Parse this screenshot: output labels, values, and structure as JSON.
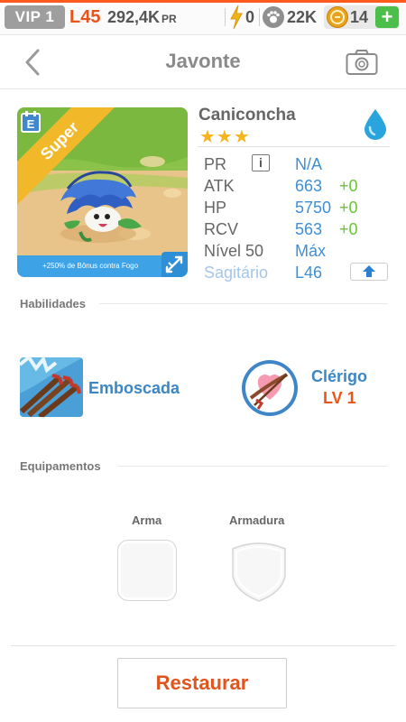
{
  "status_bar": {
    "vip": "VIP 1",
    "level": "L45",
    "pr_value": "292,4K",
    "pr_unit": "PR",
    "energy": "0",
    "paw_count": "22K",
    "coins": "14",
    "add_label": "+"
  },
  "nav": {
    "title": "Javonte"
  },
  "card": {
    "rarity": "Super",
    "bonus_text": "+250% de Bônus contra Fogo",
    "type_letter": "E"
  },
  "monster": {
    "name": "Caniconcha",
    "stars": "★★★",
    "element_icon": "water-drop-icon",
    "stats": [
      {
        "label": "PR",
        "value": "N/A",
        "bonus": ""
      },
      {
        "label": "ATK",
        "value": "663",
        "bonus": "+0"
      },
      {
        "label": "HP",
        "value": "5750",
        "bonus": "+0"
      },
      {
        "label": "RCV",
        "value": "563",
        "bonus": "+0"
      },
      {
        "label": "Nível 50",
        "value": "Máx",
        "bonus": ""
      },
      {
        "label": "Sagitário",
        "value": "L46",
        "bonus": ""
      }
    ],
    "info_icon_label": "i"
  },
  "abilities": {
    "title": "Habilidades",
    "skill1": {
      "name": "Emboscada",
      "icon": "arrows-icon"
    },
    "skill2": {
      "name": "Clérigo",
      "level": "LV 1",
      "icon": "heart-bow-icon"
    }
  },
  "equipment": {
    "title": "Equipamentos",
    "weapon_label": "Arma",
    "armor_label": "Armadura"
  },
  "restore_label": "Restaurar",
  "colors": {
    "accent_orange": "#e8531a",
    "stat_blue": "#3d8fd6",
    "bonus_green": "#6cc13d",
    "skill_blue": "#3b86c5",
    "star_gold": "#f5b51e"
  }
}
